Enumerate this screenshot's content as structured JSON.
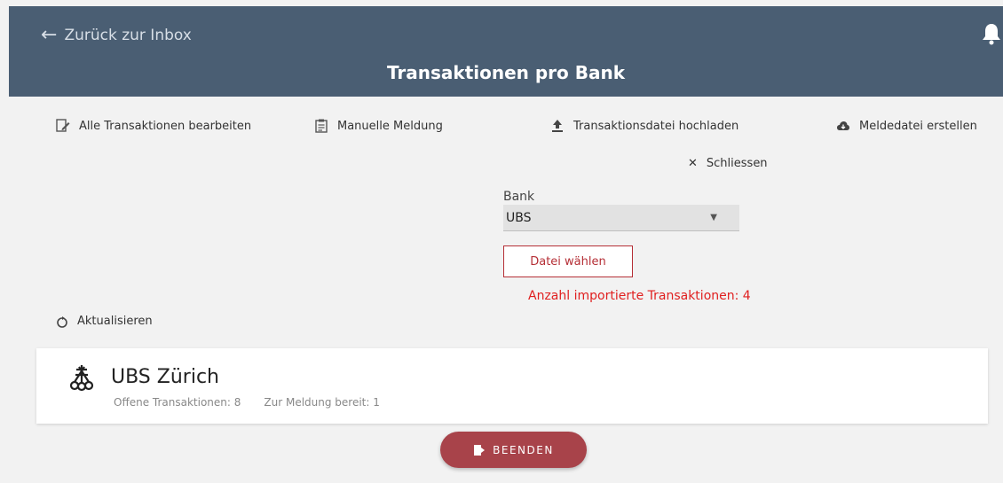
{
  "header": {
    "back_label": "Zurück zur Inbox",
    "title": "Transaktionen pro Bank",
    "icons": {
      "back": "arrow-left-icon",
      "notification": "bell-icon"
    }
  },
  "toolbar": {
    "items": [
      {
        "label": "Alle Transaktionen bearbeiten",
        "icon": "edit-icon"
      },
      {
        "label": "Manuelle Meldung",
        "icon": "clipboard-icon"
      },
      {
        "label": "Transaktionsdatei hochladen",
        "icon": "upload-icon"
      },
      {
        "label": "Meldedatei erstellen",
        "icon": "cloud-download-icon"
      }
    ]
  },
  "upload_panel": {
    "close_label": "Schliessen",
    "bank_label": "Bank",
    "bank_selected": "UBS",
    "file_button_label": "Datei wählen",
    "import_message": "Anzahl importierte Transaktionen: 4"
  },
  "refresh_label": "Aktualisieren",
  "bank_card": {
    "name": "UBS Zürich",
    "open_transactions": "Offene Transaktionen: 8",
    "ready_for_report": "Zur Meldung bereit: 1",
    "logo_icon": "ubs-keys-logo"
  },
  "finish_button_label": "BEENDEN",
  "colors": {
    "header_bg": "#4a5e73",
    "accent": "#b52f36",
    "finish_button": "#a8434a",
    "error_text": "#e02020"
  }
}
